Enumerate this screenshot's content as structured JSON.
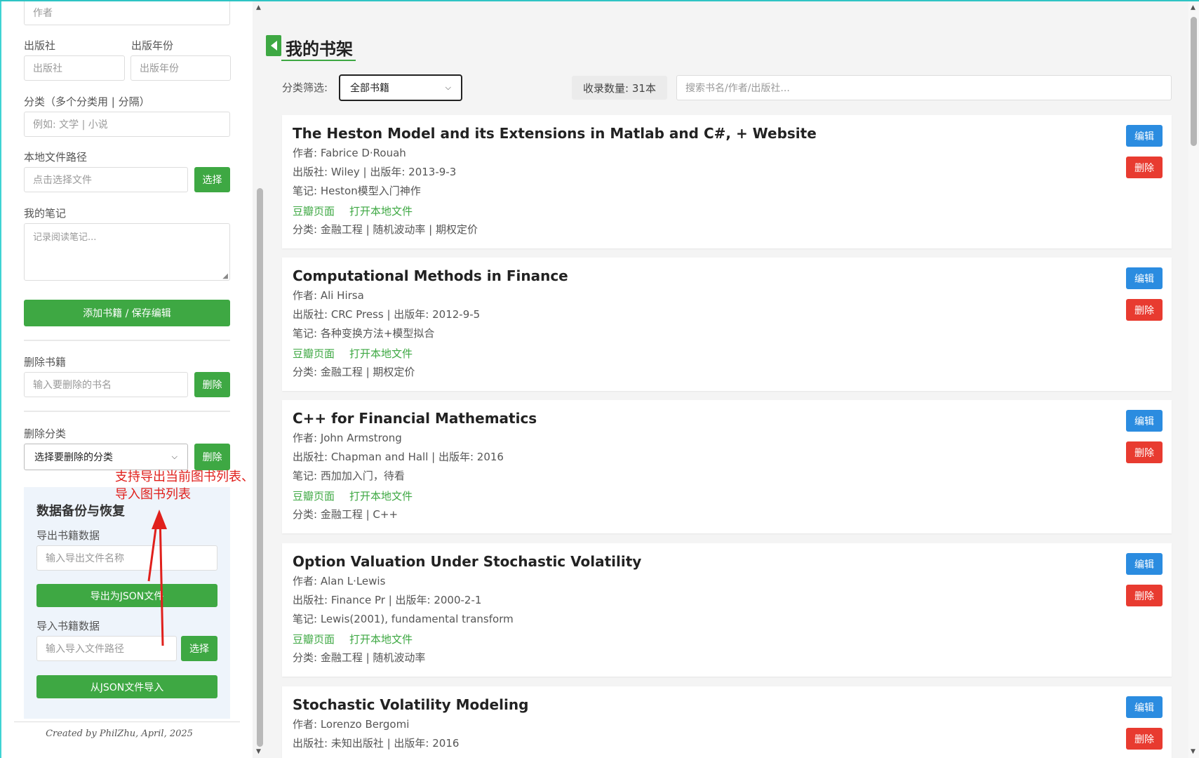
{
  "sidebar": {
    "author_placeholder": "作者",
    "publisher_label": "出版社",
    "publisher_placeholder": "出版社",
    "year_label": "出版年份",
    "year_placeholder": "出版年份",
    "category_label": "分类（多个分类用 | 分隔）",
    "category_placeholder": "例如: 文学 | 小说",
    "filepath_label": "本地文件路径",
    "filepath_placeholder": "点击选择文件",
    "choose_label": "选择",
    "notes_label": "我的笔记",
    "notes_placeholder": "记录阅读笔记...",
    "add_button": "添加书籍 / 保存编辑",
    "delete_book_label": "删除书籍",
    "delete_book_placeholder": "输入要删除的书名",
    "delete_button": "删除",
    "delete_category_label": "删除分类",
    "delete_category_select": "选择要删除的分类",
    "backup": {
      "title": "数据备份与恢复",
      "export_label": "导出书籍数据",
      "export_placeholder": "输入导出文件名称",
      "export_button": "导出为JSON文件",
      "import_label": "导入书籍数据",
      "import_placeholder": "输入导入文件路径",
      "choose_label": "选择",
      "import_button": "从JSON文件导入"
    },
    "annotation_line1": "支持导出当前图书列表、",
    "annotation_line2": "导入图书列表",
    "footer": "Created by PhilZhu, April, 2025"
  },
  "main": {
    "title": "我的书架",
    "filter_label": "分类筛选:",
    "filter_value": "全部书籍",
    "count": "收录数量: 31本",
    "search_placeholder": "搜索书名/作者/出版社...",
    "edit_label": "编辑",
    "delete_label": "删除",
    "douban_link": "豆瓣页面",
    "open_file_link": "打开本地文件",
    "books": [
      {
        "title": "The Heston Model and its Extensions in Matlab and C#, + Website",
        "author": "作者: Fabrice D·Rouah",
        "publisher": "出版社: Wiley | 出版年: 2013-9-3",
        "note": "笔记: Heston模型入门神作",
        "category": "分类: 金融工程 | 随机波动率 | 期权定价"
      },
      {
        "title": "Computational Methods in Finance",
        "author": "作者: Ali Hirsa",
        "publisher": "出版社: CRC Press | 出版年: 2012-9-5",
        "note": "笔记: 各种变换方法+模型拟合",
        "category": "分类: 金融工程 | 期权定价"
      },
      {
        "title": "C++ for Financial Mathematics",
        "author": "作者: John Armstrong",
        "publisher": "出版社: Chapman and Hall | 出版年: 2016",
        "note": "笔记: 西加加入门，待看",
        "category": "分类: 金融工程 | C++"
      },
      {
        "title": "Option Valuation Under Stochastic Volatility",
        "author": "作者: Alan L·Lewis",
        "publisher": "出版社: Finance Pr | 出版年: 2000-2-1",
        "note": "笔记: Lewis(2001), fundamental transform",
        "category": "分类: 金融工程 | 随机波动率"
      },
      {
        "title": "Stochastic Volatility Modeling",
        "author": "作者: Lorenzo Bergomi",
        "publisher": "出版社: 未知出版社 | 出版年: 2016",
        "note": "",
        "category": ""
      }
    ]
  },
  "colors": {
    "green": "#3ea843",
    "blue": "#2b8ce0",
    "red": "#e83b30",
    "annotation": "#e0201c"
  }
}
